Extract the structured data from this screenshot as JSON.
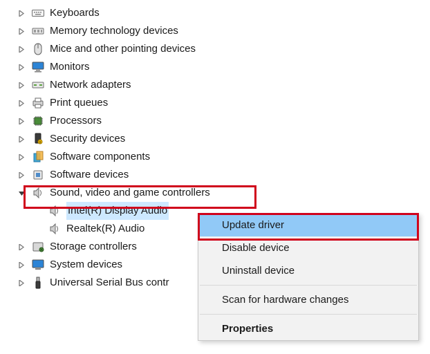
{
  "tree": {
    "items": [
      {
        "label": "Keyboards",
        "icon": "keyboard-icon"
      },
      {
        "label": "Memory technology devices",
        "icon": "memory-icon"
      },
      {
        "label": "Mice and other pointing devices",
        "icon": "mouse-icon"
      },
      {
        "label": "Monitors",
        "icon": "monitor-icon"
      },
      {
        "label": "Network adapters",
        "icon": "network-icon"
      },
      {
        "label": "Print queues",
        "icon": "printer-icon"
      },
      {
        "label": "Processors",
        "icon": "processor-icon"
      },
      {
        "label": "Security devices",
        "icon": "security-icon"
      },
      {
        "label": "Software components",
        "icon": "component-icon"
      },
      {
        "label": "Software devices",
        "icon": "softdev-icon"
      }
    ],
    "expanded": {
      "label": "Sound, video and game controllers",
      "icon": "speaker-icon",
      "children": [
        {
          "label": "Intel(R) Display Audio",
          "icon": "speaker-icon",
          "selected": true
        },
        {
          "label": "Realtek(R) Audio",
          "icon": "speaker-icon",
          "selected": false
        }
      ]
    },
    "after": [
      {
        "label": "Storage controllers",
        "icon": "storage-icon"
      },
      {
        "label": "System devices",
        "icon": "system-icon"
      },
      {
        "label": "Universal Serial Bus contr",
        "icon": "usb-icon"
      }
    ]
  },
  "context_menu": {
    "items": [
      {
        "label": "Update driver",
        "selected": true
      },
      {
        "label": "Disable device"
      },
      {
        "label": "Uninstall device"
      },
      {
        "sep": true
      },
      {
        "label": "Scan for hardware changes"
      },
      {
        "sep": true
      },
      {
        "label": "Properties",
        "bold": true
      }
    ]
  }
}
